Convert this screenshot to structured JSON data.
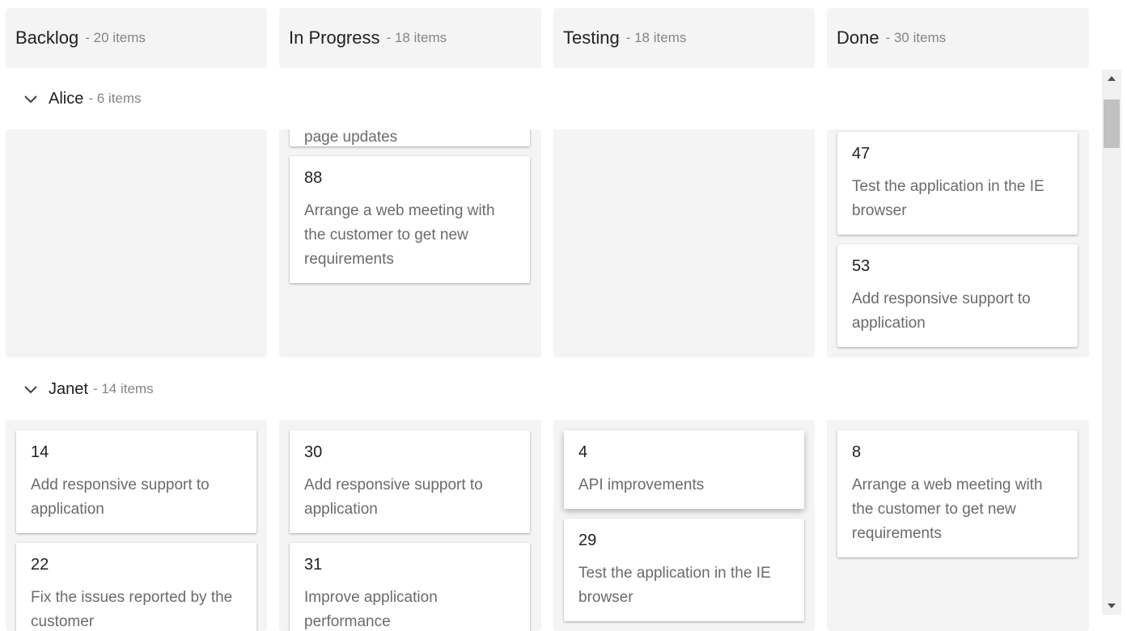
{
  "columns": [
    {
      "title": "Backlog",
      "count": "- 20 items"
    },
    {
      "title": "In Progress",
      "count": "- 18 items"
    },
    {
      "title": "Testing",
      "count": "- 18 items"
    },
    {
      "title": "Done",
      "count": "- 30 items"
    }
  ],
  "lanes": [
    {
      "name": "Alice",
      "count": "- 6 items"
    },
    {
      "name": "Janet",
      "count": "- 14 items"
    }
  ],
  "alice": {
    "inprogress": [
      {
        "id": "",
        "text": "page updates"
      },
      {
        "id": "88",
        "text": "Arrange a web meeting with the customer to get new requirements"
      }
    ],
    "done": [
      {
        "id": "47",
        "text": "Test the application in the IE browser"
      },
      {
        "id": "53",
        "text": "Add responsive support to application"
      }
    ]
  },
  "janet": {
    "backlog": [
      {
        "id": "14",
        "text": "Add responsive support to application"
      },
      {
        "id": "22",
        "text": "Fix the issues reported by the customer"
      }
    ],
    "inprogress": [
      {
        "id": "30",
        "text": "Add responsive support to application"
      },
      {
        "id": "31",
        "text": "Improve application performance"
      }
    ],
    "testing": [
      {
        "id": "4",
        "text": "API improvements"
      },
      {
        "id": "29",
        "text": "Test the application in the IE browser"
      }
    ],
    "done": [
      {
        "id": "8",
        "text": "Arrange a web meeting with the customer to get new requirements"
      }
    ]
  },
  "icons": {
    "lane_toggle": "chevron-down-icon",
    "scroll_up": "scroll-up-arrow-icon",
    "scroll_down": "scroll-down-arrow-icon"
  },
  "colors": {
    "column_bg": "#f4f4f4",
    "card_bg": "#ffffff",
    "title_text": "#212121",
    "muted_text": "#858585",
    "card_text": "#6b6b6b"
  }
}
